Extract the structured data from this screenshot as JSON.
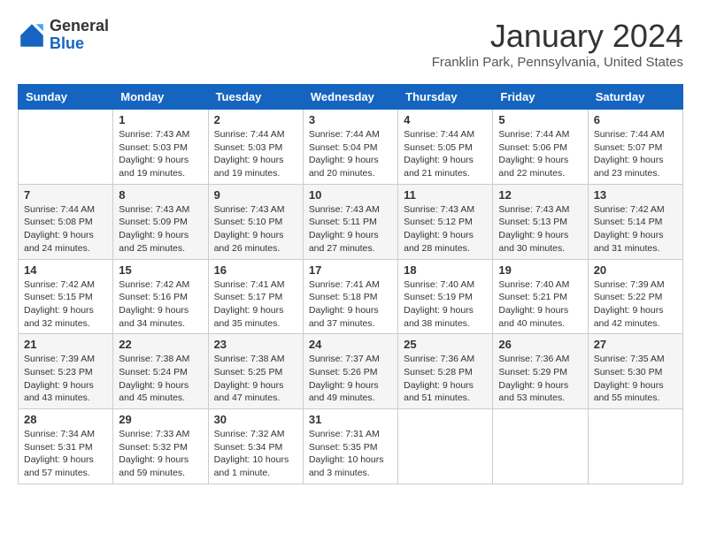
{
  "header": {
    "logo_line1": "General",
    "logo_line2": "Blue",
    "month_title": "January 2024",
    "subtitle": "Franklin Park, Pennsylvania, United States"
  },
  "weekdays": [
    "Sunday",
    "Monday",
    "Tuesday",
    "Wednesday",
    "Thursday",
    "Friday",
    "Saturday"
  ],
  "weeks": [
    [
      {
        "day": "",
        "sunrise": "",
        "sunset": "",
        "daylight": ""
      },
      {
        "day": "1",
        "sunrise": "Sunrise: 7:43 AM",
        "sunset": "Sunset: 5:03 PM",
        "daylight": "Daylight: 9 hours and 19 minutes."
      },
      {
        "day": "2",
        "sunrise": "Sunrise: 7:44 AM",
        "sunset": "Sunset: 5:03 PM",
        "daylight": "Daylight: 9 hours and 19 minutes."
      },
      {
        "day": "3",
        "sunrise": "Sunrise: 7:44 AM",
        "sunset": "Sunset: 5:04 PM",
        "daylight": "Daylight: 9 hours and 20 minutes."
      },
      {
        "day": "4",
        "sunrise": "Sunrise: 7:44 AM",
        "sunset": "Sunset: 5:05 PM",
        "daylight": "Daylight: 9 hours and 21 minutes."
      },
      {
        "day": "5",
        "sunrise": "Sunrise: 7:44 AM",
        "sunset": "Sunset: 5:06 PM",
        "daylight": "Daylight: 9 hours and 22 minutes."
      },
      {
        "day": "6",
        "sunrise": "Sunrise: 7:44 AM",
        "sunset": "Sunset: 5:07 PM",
        "daylight": "Daylight: 9 hours and 23 minutes."
      }
    ],
    [
      {
        "day": "7",
        "sunrise": "Sunrise: 7:44 AM",
        "sunset": "Sunset: 5:08 PM",
        "daylight": "Daylight: 9 hours and 24 minutes."
      },
      {
        "day": "8",
        "sunrise": "Sunrise: 7:43 AM",
        "sunset": "Sunset: 5:09 PM",
        "daylight": "Daylight: 9 hours and 25 minutes."
      },
      {
        "day": "9",
        "sunrise": "Sunrise: 7:43 AM",
        "sunset": "Sunset: 5:10 PM",
        "daylight": "Daylight: 9 hours and 26 minutes."
      },
      {
        "day": "10",
        "sunrise": "Sunrise: 7:43 AM",
        "sunset": "Sunset: 5:11 PM",
        "daylight": "Daylight: 9 hours and 27 minutes."
      },
      {
        "day": "11",
        "sunrise": "Sunrise: 7:43 AM",
        "sunset": "Sunset: 5:12 PM",
        "daylight": "Daylight: 9 hours and 28 minutes."
      },
      {
        "day": "12",
        "sunrise": "Sunrise: 7:43 AM",
        "sunset": "Sunset: 5:13 PM",
        "daylight": "Daylight: 9 hours and 30 minutes."
      },
      {
        "day": "13",
        "sunrise": "Sunrise: 7:42 AM",
        "sunset": "Sunset: 5:14 PM",
        "daylight": "Daylight: 9 hours and 31 minutes."
      }
    ],
    [
      {
        "day": "14",
        "sunrise": "Sunrise: 7:42 AM",
        "sunset": "Sunset: 5:15 PM",
        "daylight": "Daylight: 9 hours and 32 minutes."
      },
      {
        "day": "15",
        "sunrise": "Sunrise: 7:42 AM",
        "sunset": "Sunset: 5:16 PM",
        "daylight": "Daylight: 9 hours and 34 minutes."
      },
      {
        "day": "16",
        "sunrise": "Sunrise: 7:41 AM",
        "sunset": "Sunset: 5:17 PM",
        "daylight": "Daylight: 9 hours and 35 minutes."
      },
      {
        "day": "17",
        "sunrise": "Sunrise: 7:41 AM",
        "sunset": "Sunset: 5:18 PM",
        "daylight": "Daylight: 9 hours and 37 minutes."
      },
      {
        "day": "18",
        "sunrise": "Sunrise: 7:40 AM",
        "sunset": "Sunset: 5:19 PM",
        "daylight": "Daylight: 9 hours and 38 minutes."
      },
      {
        "day": "19",
        "sunrise": "Sunrise: 7:40 AM",
        "sunset": "Sunset: 5:21 PM",
        "daylight": "Daylight: 9 hours and 40 minutes."
      },
      {
        "day": "20",
        "sunrise": "Sunrise: 7:39 AM",
        "sunset": "Sunset: 5:22 PM",
        "daylight": "Daylight: 9 hours and 42 minutes."
      }
    ],
    [
      {
        "day": "21",
        "sunrise": "Sunrise: 7:39 AM",
        "sunset": "Sunset: 5:23 PM",
        "daylight": "Daylight: 9 hours and 43 minutes."
      },
      {
        "day": "22",
        "sunrise": "Sunrise: 7:38 AM",
        "sunset": "Sunset: 5:24 PM",
        "daylight": "Daylight: 9 hours and 45 minutes."
      },
      {
        "day": "23",
        "sunrise": "Sunrise: 7:38 AM",
        "sunset": "Sunset: 5:25 PM",
        "daylight": "Daylight: 9 hours and 47 minutes."
      },
      {
        "day": "24",
        "sunrise": "Sunrise: 7:37 AM",
        "sunset": "Sunset: 5:26 PM",
        "daylight": "Daylight: 9 hours and 49 minutes."
      },
      {
        "day": "25",
        "sunrise": "Sunrise: 7:36 AM",
        "sunset": "Sunset: 5:28 PM",
        "daylight": "Daylight: 9 hours and 51 minutes."
      },
      {
        "day": "26",
        "sunrise": "Sunrise: 7:36 AM",
        "sunset": "Sunset: 5:29 PM",
        "daylight": "Daylight: 9 hours and 53 minutes."
      },
      {
        "day": "27",
        "sunrise": "Sunrise: 7:35 AM",
        "sunset": "Sunset: 5:30 PM",
        "daylight": "Daylight: 9 hours and 55 minutes."
      }
    ],
    [
      {
        "day": "28",
        "sunrise": "Sunrise: 7:34 AM",
        "sunset": "Sunset: 5:31 PM",
        "daylight": "Daylight: 9 hours and 57 minutes."
      },
      {
        "day": "29",
        "sunrise": "Sunrise: 7:33 AM",
        "sunset": "Sunset: 5:32 PM",
        "daylight": "Daylight: 9 hours and 59 minutes."
      },
      {
        "day": "30",
        "sunrise": "Sunrise: 7:32 AM",
        "sunset": "Sunset: 5:34 PM",
        "daylight": "Daylight: 10 hours and 1 minute."
      },
      {
        "day": "31",
        "sunrise": "Sunrise: 7:31 AM",
        "sunset": "Sunset: 5:35 PM",
        "daylight": "Daylight: 10 hours and 3 minutes."
      },
      {
        "day": "",
        "sunrise": "",
        "sunset": "",
        "daylight": ""
      },
      {
        "day": "",
        "sunrise": "",
        "sunset": "",
        "daylight": ""
      },
      {
        "day": "",
        "sunrise": "",
        "sunset": "",
        "daylight": ""
      }
    ]
  ]
}
